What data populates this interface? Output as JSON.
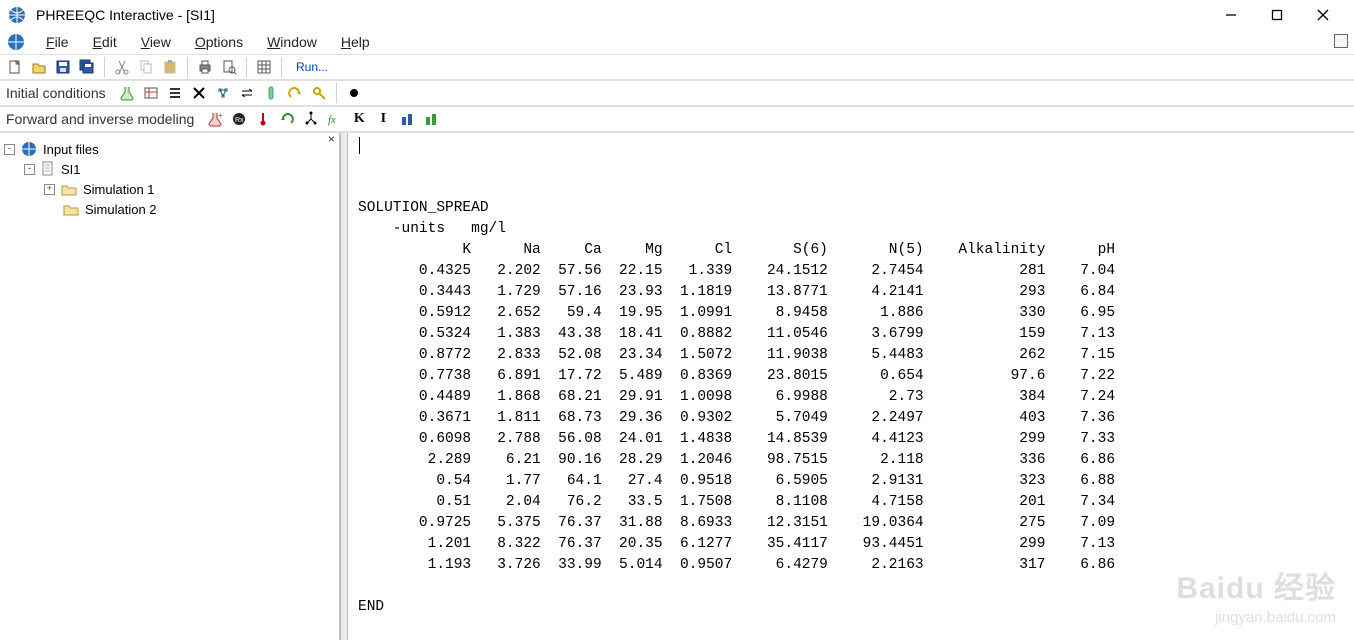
{
  "window": {
    "title": "PHREEQC Interactive - [SI1]"
  },
  "menus": [
    "File",
    "Edit",
    "View",
    "Options",
    "Window",
    "Help"
  ],
  "toolbar_main": {
    "run_label": "Run..."
  },
  "toolbar_labels": {
    "init": "Initial conditions",
    "model": "Forward and inverse modeling",
    "k": "K",
    "i": "I"
  },
  "tree": {
    "root": "Input files",
    "file": "SI1",
    "sims": [
      "Simulation 1",
      "Simulation 2"
    ]
  },
  "editor": {
    "keyword": "SOLUTION_SPREAD",
    "units_line": "-units   mg/l",
    "headers": [
      "K",
      "Na",
      "Ca",
      "Mg",
      "Cl",
      "S(6)",
      "N(5)",
      "Alkalinity",
      "pH"
    ],
    "rows": [
      [
        "0.4325",
        "2.202",
        "57.56",
        "22.15",
        "1.339",
        "24.1512",
        "2.7454",
        "281",
        "7.04"
      ],
      [
        "0.3443",
        "1.729",
        "57.16",
        "23.93",
        "1.1819",
        "13.8771",
        "4.2141",
        "293",
        "6.84"
      ],
      [
        "0.5912",
        "2.652",
        "59.4",
        "19.95",
        "1.0991",
        "8.9458",
        "1.886",
        "330",
        "6.95"
      ],
      [
        "0.5324",
        "1.383",
        "43.38",
        "18.41",
        "0.8882",
        "11.0546",
        "3.6799",
        "159",
        "7.13"
      ],
      [
        "0.8772",
        "2.833",
        "52.08",
        "23.34",
        "1.5072",
        "11.9038",
        "5.4483",
        "262",
        "7.15"
      ],
      [
        "0.7738",
        "6.891",
        "17.72",
        "5.489",
        "0.8369",
        "23.8015",
        "0.654",
        "97.6",
        "7.22"
      ],
      [
        "0.4489",
        "1.868",
        "68.21",
        "29.91",
        "1.0098",
        "6.9988",
        "2.73",
        "384",
        "7.24"
      ],
      [
        "0.3671",
        "1.811",
        "68.73",
        "29.36",
        "0.9302",
        "5.7049",
        "2.2497",
        "403",
        "7.36"
      ],
      [
        "0.6098",
        "2.788",
        "56.08",
        "24.01",
        "1.4838",
        "14.8539",
        "4.4123",
        "299",
        "7.33"
      ],
      [
        "2.289",
        "6.21",
        "90.16",
        "28.29",
        "1.2046",
        "98.7515",
        "2.118",
        "336",
        "6.86"
      ],
      [
        "0.54",
        "1.77",
        "64.1",
        "27.4",
        "0.9518",
        "6.5905",
        "2.9131",
        "323",
        "6.88"
      ],
      [
        "0.51",
        "2.04",
        "76.2",
        "33.5",
        "1.7508",
        "8.1108",
        "4.7158",
        "201",
        "7.34"
      ],
      [
        "0.9725",
        "5.375",
        "76.37",
        "31.88",
        "8.6933",
        "12.3151",
        "19.0364",
        "275",
        "7.09"
      ],
      [
        "1.201",
        "8.322",
        "76.37",
        "20.35",
        "6.1277",
        "35.4117",
        "93.4451",
        "299",
        "7.13"
      ],
      [
        "1.193",
        "3.726",
        "33.99",
        "5.014",
        "0.9507",
        "6.4279",
        "2.2163",
        "317",
        "6.86"
      ]
    ],
    "end": "END"
  },
  "watermark": {
    "big": "Baidu 经验",
    "small": "jingyan.baidu.com"
  }
}
